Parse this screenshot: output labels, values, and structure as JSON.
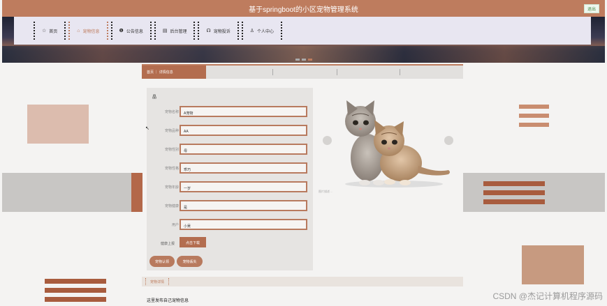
{
  "header": {
    "title": "基于springboot的小区宠物管理系统",
    "exit_label": "退出"
  },
  "nav": {
    "items": [
      {
        "label": "首页",
        "icon": "star-icon",
        "glyph": "☆"
      },
      {
        "label": "宠物信息",
        "icon": "house-icon",
        "glyph": "⌂"
      },
      {
        "label": "公告信息",
        "icon": "info-icon",
        "glyph": "❶"
      },
      {
        "label": "后台管理",
        "icon": "database-icon",
        "glyph": "▤"
      },
      {
        "label": "宠物投诉",
        "icon": "headset-icon",
        "glyph": "☊"
      },
      {
        "label": "个人中心",
        "icon": "user-icon",
        "glyph": "♙"
      }
    ],
    "active_index": 1
  },
  "breadcrumb": {
    "home": "首页",
    "current": "详情信息"
  },
  "detail": {
    "title": "晶",
    "fields": [
      {
        "label": "宠物名称",
        "value": "A宠物"
      },
      {
        "label": "宠物品种",
        "value": "AA"
      },
      {
        "label": "宠物性别",
        "value": "母"
      },
      {
        "label": "宠物性格",
        "value": "乖巧"
      },
      {
        "label": "宠物年龄",
        "value": "一岁"
      },
      {
        "label": "宠物健康",
        "value": "是"
      },
      {
        "label": "用户",
        "value": "小吴"
      }
    ],
    "download_label": "健康上报",
    "download_button": "点击下载",
    "action_buttons": [
      "宠物认领",
      "宠物丢失"
    ]
  },
  "gallery": {
    "caption": "图片描述 ..."
  },
  "lower": {
    "tab_label": "宠物详情",
    "publish_text": "这里发布自己宠物信息"
  },
  "watermark": "CSDN @杰记计算机程序源码",
  "colors": {
    "brand": "#be7c5e",
    "brand_dark": "#b36d4f",
    "panel": "#e6e4e2",
    "nav_bg": "#e8e6f1"
  }
}
